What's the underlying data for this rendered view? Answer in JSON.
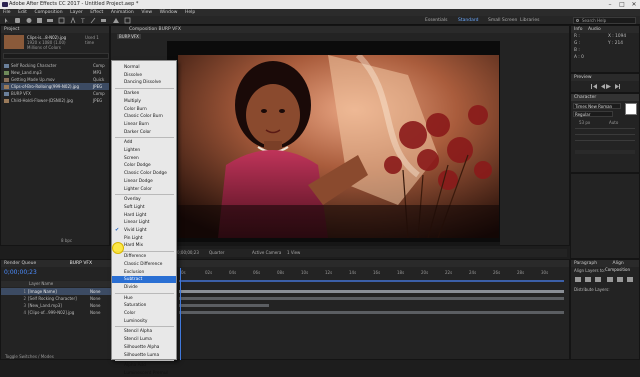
{
  "window": {
    "title": "Adobe After Effects CC 2017 - Untitled Project.aep *",
    "controls": [
      "–",
      "□",
      "✕"
    ]
  },
  "menubar": [
    "File",
    "Edit",
    "Composition",
    "Layer",
    "Effect",
    "Animation",
    "View",
    "Window",
    "Help"
  ],
  "toolbar": {
    "workspaces": [
      "Essentials",
      "Standard",
      "Small Screen",
      "Libraries"
    ],
    "search_placeholder": "Search Help"
  },
  "project": {
    "tab": "Project",
    "preview_name": "Clips-is...8-N02).jpg",
    "preview_info": [
      "1920 x 1080 (1.00)",
      "Millions of Colors"
    ],
    "used": "Used 1 time",
    "items": [
      {
        "name": "Self Rocking Character",
        "type": "Comp",
        "selected": false
      },
      {
        "name": "New_Land.mp3",
        "type": "MP3",
        "selected": false
      },
      {
        "name": "Getting Made Up.mov",
        "type": "Quick",
        "selected": false
      },
      {
        "name": "Clips-of-Bro-Rolloing(999-N02).jpg",
        "type": "JPEG",
        "selected": true
      },
      {
        "name": "BURP VFX",
        "type": "Comp",
        "selected": false
      },
      {
        "name": "Child-Holdi-Flower-(DSN02).jpg",
        "type": "JPEG",
        "selected": false
      }
    ],
    "footer": "8 bpc"
  },
  "composition": {
    "tab": "Composition BURP VFX",
    "subtab": "BURP VFX"
  },
  "viewer_bar": {
    "zoom": "Quarter",
    "camera": "Active Camera",
    "views": "1 View",
    "time": "0;00;00;23"
  },
  "blend_menu": {
    "items": [
      "Normal",
      "Dissolve",
      "Dancing Dissolve",
      "Darken",
      "Multiply",
      "Color Burn",
      "Classic Color Burn",
      "Linear Burn",
      "Darker Color",
      "Add",
      "Lighten",
      "Screen",
      "Color Dodge",
      "Classic Color Dodge",
      "Linear Dodge",
      "Lighter Color",
      "Overlay",
      "Soft Light",
      "Hard Light",
      "Linear Light",
      "Vivid Light",
      "Pin Light",
      "Hard Mix",
      "Difference",
      "Classic Difference",
      "Exclusion",
      "Subtract",
      "Divide",
      "Hue",
      "Saturation",
      "Color",
      "Luminosity",
      "Stencil Alpha",
      "Stencil Luma",
      "Silhouette Alpha",
      "Silhouette Luma",
      "Alpha Add",
      "Luminescent Premul"
    ],
    "checked": "Vivid Light",
    "highlighted": "Subtract"
  },
  "right": {
    "info": {
      "tabs": [
        "Info",
        "Audio"
      ],
      "lines": [
        "R :",
        "G :",
        "B :",
        "A : 0",
        "X : 1094",
        "Y : 214"
      ]
    },
    "preview": {
      "tab": "Preview"
    },
    "character": {
      "tab": "Character",
      "font": "Times New Roman",
      "style": "Regular",
      "size": "53 px",
      "leading": "Auto"
    },
    "paragraph": {
      "tabs": [
        "Paragraph",
        "Align"
      ],
      "align_to": "Align Layers to:",
      "align_value": "Composition",
      "distribute": "Distribute Layers:"
    }
  },
  "timeline": {
    "tabs": [
      "Render Queue",
      "BURP VFX"
    ],
    "timecode": "0;00;00;23",
    "header": "Layer Name",
    "ruler": [
      "0s",
      "02s",
      "04s",
      "06s",
      "08s",
      "10s",
      "12s",
      "14s",
      "16s",
      "18s",
      "20s",
      "22s",
      "24s",
      "26s",
      "28s",
      "30s"
    ],
    "layers": [
      {
        "num": "1",
        "name": "[Image Name]",
        "parent": "None",
        "selected": true
      },
      {
        "num": "2",
        "name": "[Self Rocking Character]",
        "parent": "None",
        "selected": false
      },
      {
        "num": "3",
        "name": "[New_Land.mp3]",
        "parent": "None",
        "selected": false
      },
      {
        "num": "4",
        "name": "[Clips-of...999-N02].jpg",
        "parent": "None",
        "selected": false
      }
    ],
    "footer": "Toggle Switches / Modes"
  }
}
